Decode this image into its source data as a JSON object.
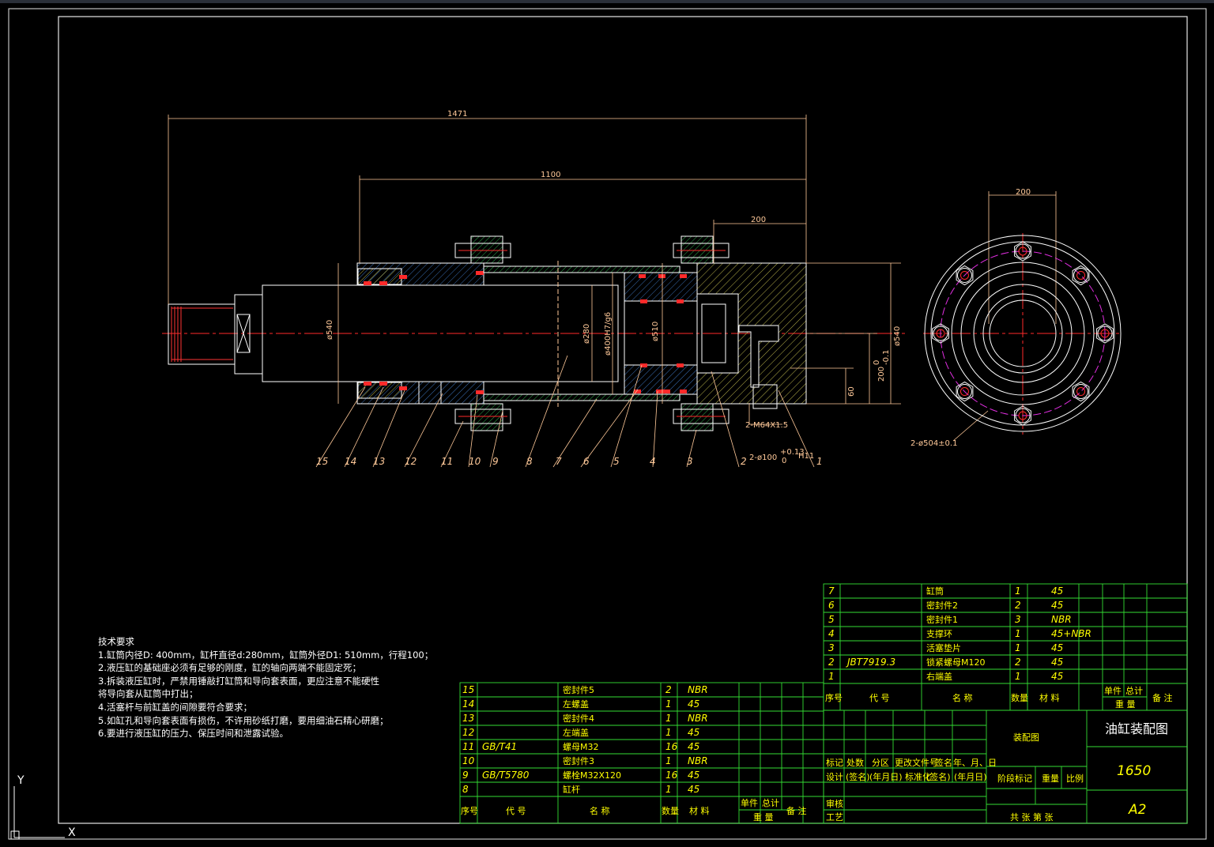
{
  "dimensions": {
    "len_1471": "1471",
    "len_1100": "1100",
    "len_200_top": "200",
    "len_200_end": "200",
    "dia_540_left": "ø540",
    "dia_280": "ø280",
    "dia_400": "ø400H7/g6",
    "dia_510": "ø510",
    "dia_540_right": "ø540",
    "len_200_tol": "200",
    "tol_0": "0",
    "tol_neg": "-0.1",
    "len_60": "60",
    "thread_m64": "2-M64X1.5",
    "bore_100": "2-ø100",
    "bore_tol_top": "+0.13",
    "bore_tol_bot": "0",
    "bore_fit": "H11",
    "pcd_504": "2-ø504±0.1"
  },
  "balloons": [
    "15",
    "14",
    "13",
    "12",
    "11",
    "10",
    "9",
    "8",
    "7",
    "6",
    "5",
    "4",
    "3",
    "2",
    "1"
  ],
  "notes": {
    "title": "技术要求",
    "lines": [
      "1.缸筒内径D: 400mm，缸杆直径d:280mm，缸筒外径D1: 510mm，行程100；",
      "2.液压缸的基础座必须有足够的刚度，缸的轴向两端不能固定死；",
      "3.拆装液压缸时，严禁用锤敲打缸筒和导向套表面，更应注意不能硬性",
      "将导向套从缸筒中打出；",
      "4.活塞杆与前缸盖的间隙要符合要求；",
      "5.如缸孔和导向套表面有损伤，不许用砂纸打磨，要用细油石精心研磨；",
      "6.要进行液压缸的压力、保压时间和泄露试验。"
    ]
  },
  "bom_right": {
    "rows": [
      {
        "no": "7",
        "code": "",
        "name": "缸筒",
        "qty": "1",
        "mat": "45"
      },
      {
        "no": "6",
        "code": "",
        "name": "密封件2",
        "qty": "2",
        "mat": "45"
      },
      {
        "no": "5",
        "code": "",
        "name": "密封件1",
        "qty": "3",
        "mat": "NBR"
      },
      {
        "no": "4",
        "code": "",
        "name": "支撑环",
        "qty": "1",
        "mat": "45+NBR"
      },
      {
        "no": "3",
        "code": "",
        "name": "活塞垫片",
        "qty": "1",
        "mat": "45"
      },
      {
        "no": "2",
        "code": "JBT7919.3",
        "name": "锁紧螺母M120",
        "qty": "2",
        "mat": "45"
      },
      {
        "no": "1",
        "code": "",
        "name": "右端盖",
        "qty": "1",
        "mat": "45"
      }
    ],
    "header": {
      "no": "序号",
      "code": "代 号",
      "name": "名 称",
      "qty": "数量",
      "mat": "材 料",
      "unit": "单件",
      "total": "总计",
      "weight": "重 量",
      "remark": "备 注"
    }
  },
  "bom_left": {
    "rows": [
      {
        "no": "15",
        "code": "",
        "name": "密封件5",
        "qty": "2",
        "mat": "NBR"
      },
      {
        "no": "14",
        "code": "",
        "name": "左螺盖",
        "qty": "1",
        "mat": "45"
      },
      {
        "no": "13",
        "code": "",
        "name": "密封件4",
        "qty": "1",
        "mat": "NBR"
      },
      {
        "no": "12",
        "code": "",
        "name": "左端盖",
        "qty": "1",
        "mat": "45"
      },
      {
        "no": "11",
        "code": "GB/T41",
        "name": "螺母M32",
        "qty": "16",
        "mat": "45"
      },
      {
        "no": "10",
        "code": "",
        "name": "密封件3",
        "qty": "1",
        "mat": "NBR"
      },
      {
        "no": "9",
        "code": "GB/T5780",
        "name": "螺栓M32X120",
        "qty": "16",
        "mat": "45"
      },
      {
        "no": "8",
        "code": "",
        "name": "缸杆",
        "qty": "1",
        "mat": "45"
      }
    ],
    "header": {
      "no": "序号",
      "code": "代 号",
      "name": "名 称",
      "qty": "数量",
      "mat": "材 料",
      "unit": "单件",
      "total": "总计",
      "weight": "重 量",
      "remark": "备 注"
    }
  },
  "title_block": {
    "drawing_type": "装配图",
    "drawing_name": "油缸装配图",
    "drawing_no": "1650",
    "sheet_size": "A2",
    "rev_header": [
      "标记",
      "处数",
      "分区",
      "更改文件号",
      "签名",
      "年、月、日"
    ],
    "design_row": [
      "设计",
      "(签名)",
      "(年月日)",
      "标准化",
      "(签名)",
      "(年月日)"
    ],
    "stage": "阶段标记",
    "weight": "重量",
    "scale": "比例",
    "review": "审核",
    "process": "工艺",
    "sheet": "共  张 第  张"
  },
  "ucs": {
    "y": "Y",
    "x": "X"
  }
}
